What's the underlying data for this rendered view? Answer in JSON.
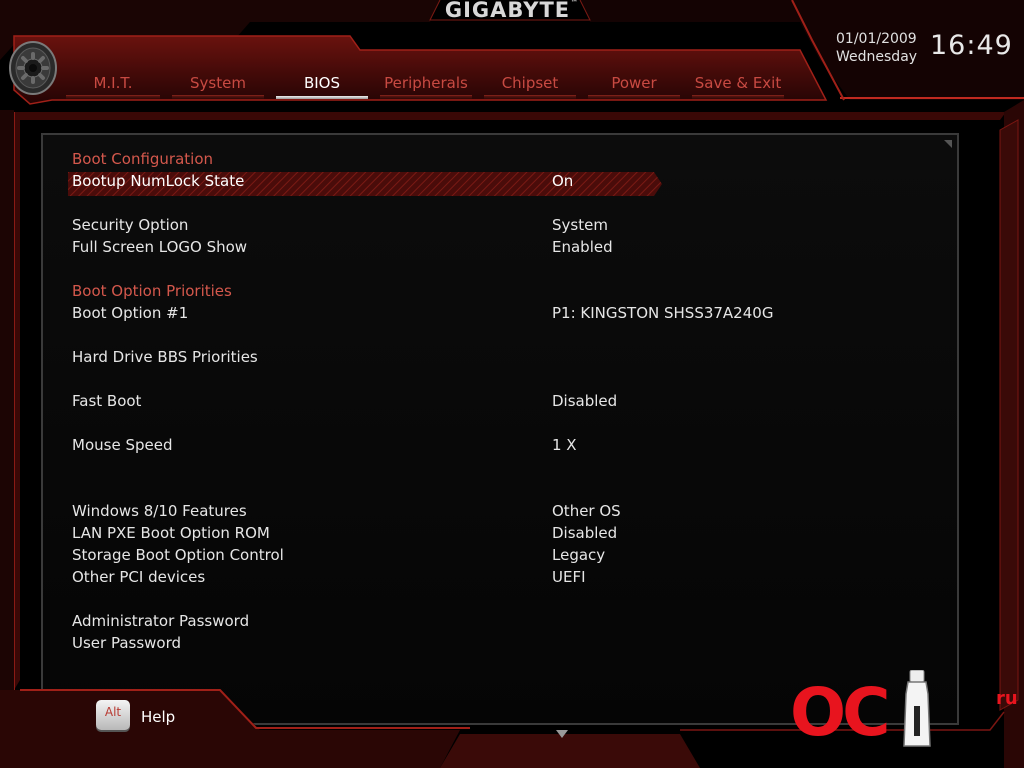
{
  "header": {
    "brand": "GIGABYTE",
    "brand_mark": "™",
    "date": "01/01/2009",
    "weekday": "Wednesday",
    "time": "16:49"
  },
  "tabs": [
    {
      "label": "M.I.T.",
      "active": false
    },
    {
      "label": "System",
      "active": false
    },
    {
      "label": "BIOS",
      "active": true
    },
    {
      "label": "Peripherals",
      "active": false
    },
    {
      "label": "Chipset",
      "active": false
    },
    {
      "label": "Power",
      "active": false
    },
    {
      "label": "Save & Exit",
      "active": false
    }
  ],
  "settings": [
    {
      "label": "Boot Configuration",
      "value": "",
      "type": "section"
    },
    {
      "label": "Bootup NumLock State",
      "value": "On",
      "type": "selected"
    },
    {
      "label": "Security Option",
      "value": "System",
      "type": "item"
    },
    {
      "label": "Full Screen LOGO Show",
      "value": "Enabled",
      "type": "item"
    },
    {
      "label": "Boot Option Priorities",
      "value": "",
      "type": "section"
    },
    {
      "label": "Boot Option #1",
      "value": "P1: KINGSTON SHSS37A240G",
      "type": "item"
    },
    {
      "label": "Hard Drive BBS Priorities",
      "value": "",
      "type": "item"
    },
    {
      "label": "Fast Boot",
      "value": "Disabled",
      "type": "item"
    },
    {
      "label": "Mouse Speed",
      "value": "1 X",
      "type": "item"
    },
    {
      "label": "Windows 8/10 Features",
      "value": "Other OS",
      "type": "item"
    },
    {
      "label": "LAN PXE Boot Option ROM",
      "value": "Disabled",
      "type": "item"
    },
    {
      "label": "Storage Boot Option Control",
      "value": "Legacy",
      "type": "item"
    },
    {
      "label": "Other PCI devices",
      "value": "UEFI",
      "type": "item"
    },
    {
      "label": "Administrator Password",
      "value": "",
      "type": "item"
    },
    {
      "label": "User Password",
      "value": "",
      "type": "item"
    }
  ],
  "footer": {
    "help_key": "Alt",
    "help_label": "Help"
  },
  "watermark": {
    "logo": "OC",
    "suffix": "ru"
  },
  "icons": {
    "settings": "gear-icon",
    "scroll": "triangle-down-icon"
  },
  "colors": {
    "accent_red": "#c84a42",
    "section_red": "#d4584c",
    "text": "#e6e6e6",
    "background": "#000000",
    "frame_red": "#8a1a14"
  }
}
